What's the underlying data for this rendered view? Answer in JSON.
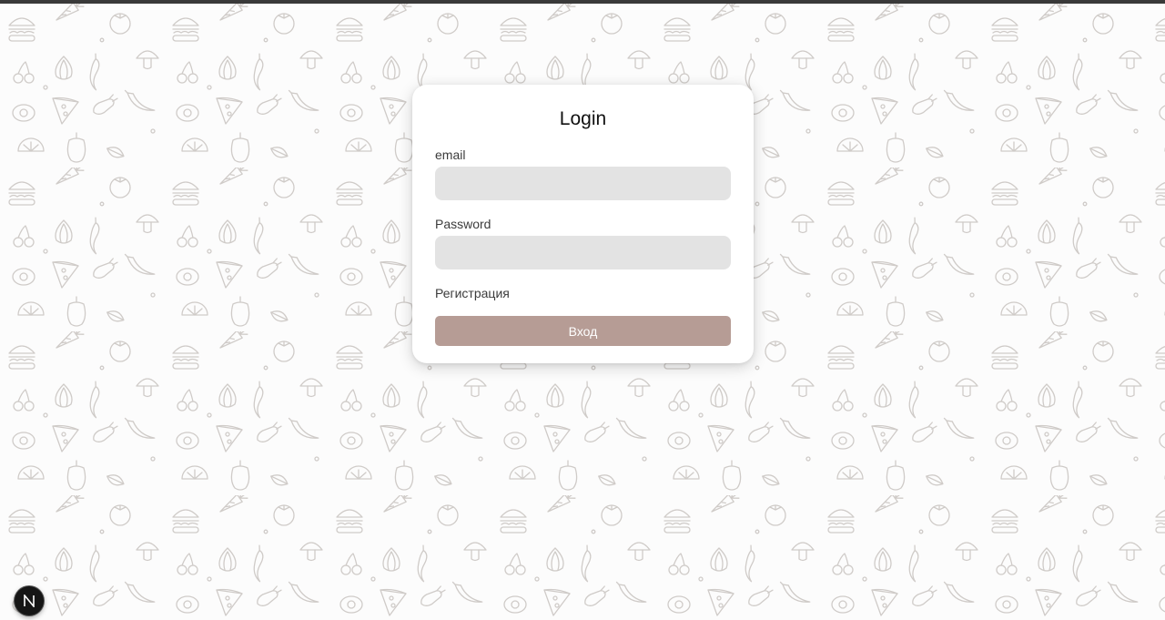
{
  "login_form": {
    "title": "Login",
    "email_label": "email",
    "email_value": "",
    "password_label": "Password",
    "password_value": "",
    "register_link": "Регистрация",
    "submit_label": "Вход"
  },
  "background": {
    "pattern_icons": [
      "burger-icon",
      "carrot-icon",
      "tomato-icon",
      "mushroom-icon",
      "cherry-icon",
      "onion-icon",
      "pepper-icon",
      "banana-icon",
      "avocado-icon",
      "pizza-icon",
      "eggplant-icon",
      "lemon-slice-icon"
    ],
    "pattern_color": "#cfcbc8"
  },
  "dev_badge": {
    "icon": "nextjs-icon"
  },
  "colors": {
    "page_background": "#fcfcfc",
    "top_bar": "#3a3a3a",
    "card_background": "#ffffff",
    "input_background": "#e3e3e3",
    "button_background": "#b69c95",
    "button_text": "#ffffff"
  }
}
